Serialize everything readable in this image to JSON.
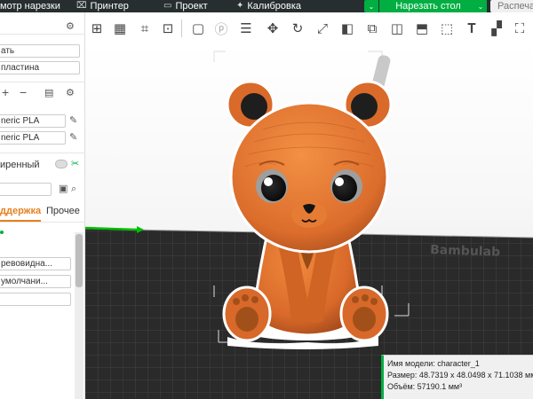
{
  "topbar": {
    "preview_tab": "мотр нарезки",
    "printer_tab": "Принтер",
    "project_tab": "Проект",
    "calibration_tab": "Калибровка",
    "slice_button": "Нарезать стол",
    "print_button": "Распеча"
  },
  "left_panel": {
    "printer_field": "ать",
    "plate_field": "пластина",
    "filament_1": "neric PLA",
    "filament_2": "neric PLA",
    "mode_label": "иренный",
    "search_value": "",
    "tab_support": "ддержка",
    "tab_other": "Прочее",
    "option_1": "ревовидна...",
    "option_2": "умолчани..."
  },
  "model_info": {
    "name": "Имя модели: character_1",
    "size": "Размер: 48.7319 x 48.0498 x 71.1038 мм",
    "volume": "Объём: 57190.1 мм³"
  },
  "plate_brand": "Bambulab",
  "colors": {
    "accent": "#00ae42",
    "active_tab": "#e5801e",
    "model": "#e8782e",
    "plate": "#2a2a2a"
  }
}
